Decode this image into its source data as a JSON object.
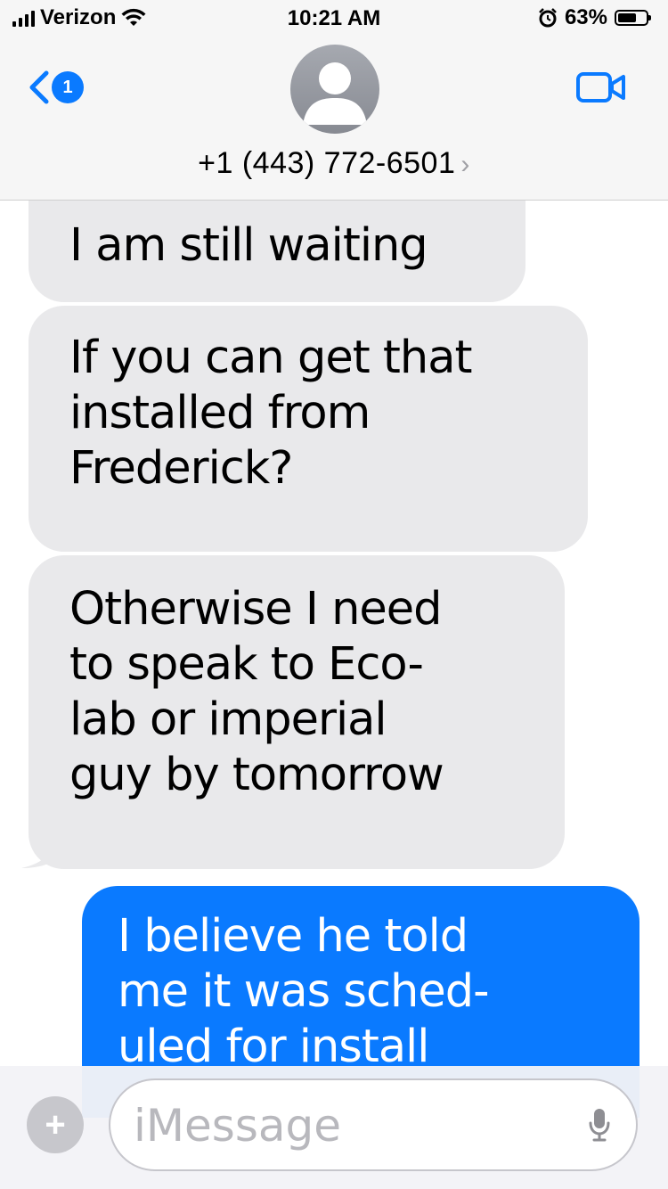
{
  "status_bar": {
    "carrier": "Verizon",
    "time": "10:21 AM",
    "battery": "63%",
    "battery_level": 0.63,
    "icons": [
      "signal-icon",
      "wifi-icon",
      "alarm-icon",
      "battery-icon"
    ]
  },
  "header": {
    "back_badge": "1",
    "contact": "+1 (443) 772-6501",
    "chevron": "›",
    "icons": [
      "back-chevron-icon",
      "avatar-icon",
      "video-call-icon"
    ]
  },
  "messages": [
    {
      "type": "received",
      "text": "I am still waiting"
    },
    {
      "type": "received",
      "text": "If you can get that\ninstalled from\nFrederick?"
    },
    {
      "type": "received",
      "text": "Otherwise I need\nto speak to Eco-\nlab or imperial\nguy by tomorrow"
    },
    {
      "type": "sent",
      "text": "I believe he told\nme it was sched-\nuled for install"
    }
  ],
  "input": {
    "plus": "+",
    "placeholder": "iMessage",
    "icons": [
      "microphone-icon"
    ]
  },
  "colors": {
    "sent_bubble": "#0a7aff",
    "received_bubble": "#e9e9eb",
    "accent": "#0a7aff"
  }
}
